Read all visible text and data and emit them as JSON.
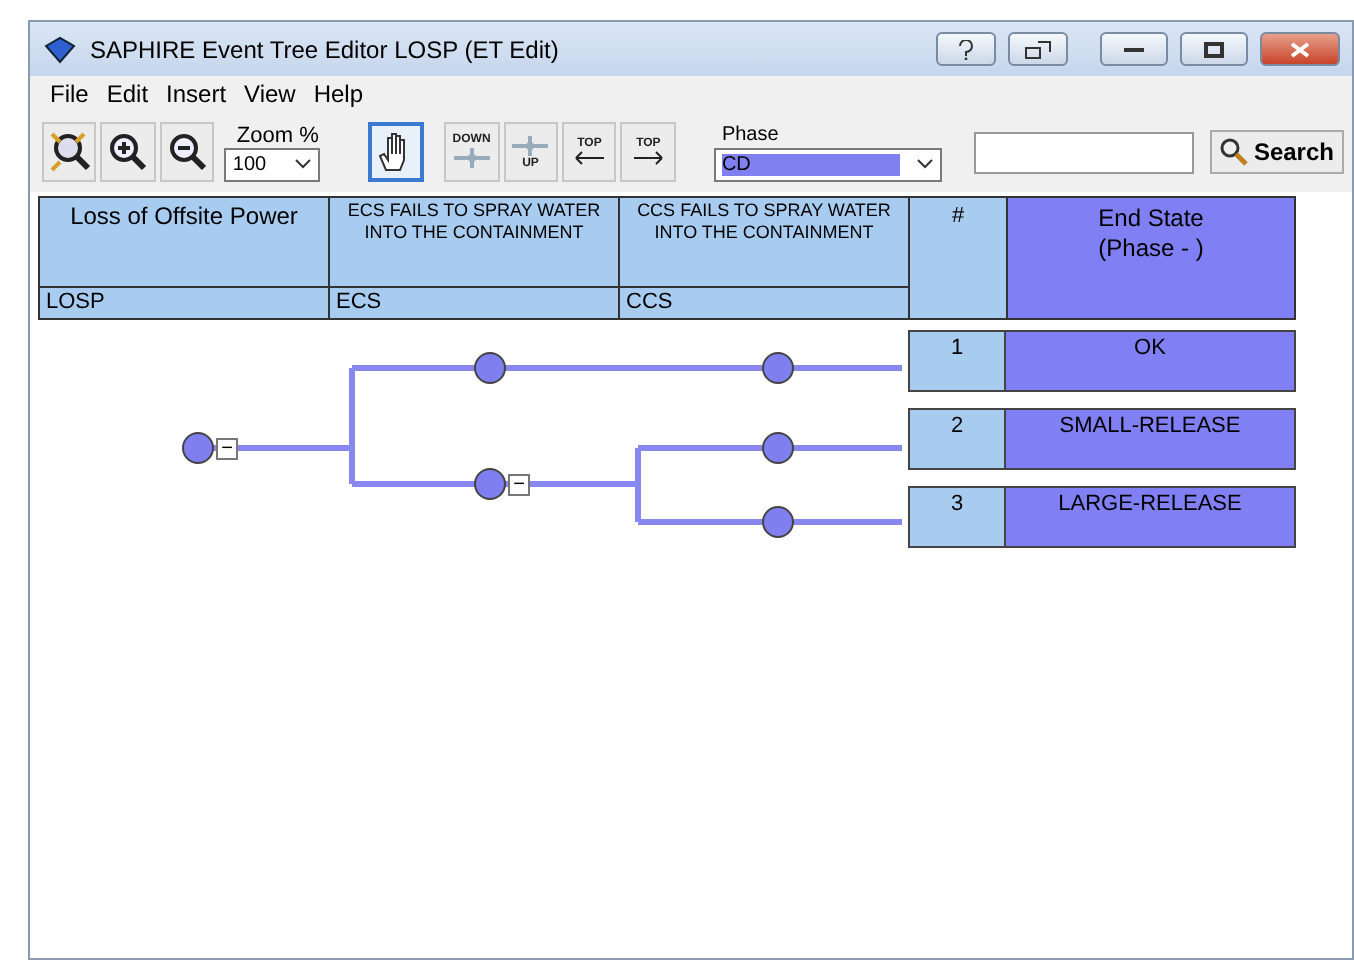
{
  "window": {
    "title": "SAPHIRE Event Tree Editor LOSP (ET Edit)"
  },
  "menu": [
    "File",
    "Edit",
    "Insert",
    "View",
    "Help"
  ],
  "toolbar": {
    "tools": [
      {
        "kind": "fit",
        "selected": false
      },
      {
        "kind": "zoom-in",
        "selected": false
      },
      {
        "kind": "zoom-out",
        "selected": false
      }
    ],
    "zoom": {
      "label": "Zoom %",
      "value": "100"
    },
    "modes": [
      {
        "kind": "hand",
        "selected": true
      },
      {
        "kind": "down",
        "label": "DOWN",
        "selected": false
      },
      {
        "kind": "up",
        "label": "UP",
        "selected": false
      },
      {
        "kind": "top-left",
        "label": "TOP",
        "selected": false
      },
      {
        "kind": "top-right",
        "label": "TOP",
        "selected": false
      }
    ],
    "phase": {
      "label": "Phase",
      "value": "CD"
    },
    "search": {
      "button": "Search"
    }
  },
  "header": {
    "events": [
      {
        "title": "Loss of Offsite Power",
        "name": "LOSP",
        "kind": "initiator"
      },
      {
        "title": "ECS FAILS TO SPRAY WATER INTO THE CONTAINMENT",
        "name": "ECS",
        "kind": "top"
      },
      {
        "title": "CCS FAILS TO SPRAY WATER INTO THE CONTAINMENT",
        "name": "CCS",
        "kind": "top"
      }
    ],
    "number_column": "#",
    "end_state": "End State",
    "phase_note": "(Phase - )"
  },
  "tree": {
    "nodes": [
      {
        "kind": "collapsible",
        "symbol": "−"
      },
      {
        "kind": "plain"
      },
      {
        "kind": "collapsible",
        "symbol": "−"
      },
      {
        "kind": "plain"
      },
      {
        "kind": "plain"
      },
      {
        "kind": "plain"
      }
    ]
  },
  "sequences": [
    {
      "number": "1",
      "end_state": "OK"
    },
    {
      "number": "2",
      "end_state": "SMALL-RELEASE"
    },
    {
      "number": "3",
      "end_state": "LARGE-RELEASE"
    }
  ]
}
